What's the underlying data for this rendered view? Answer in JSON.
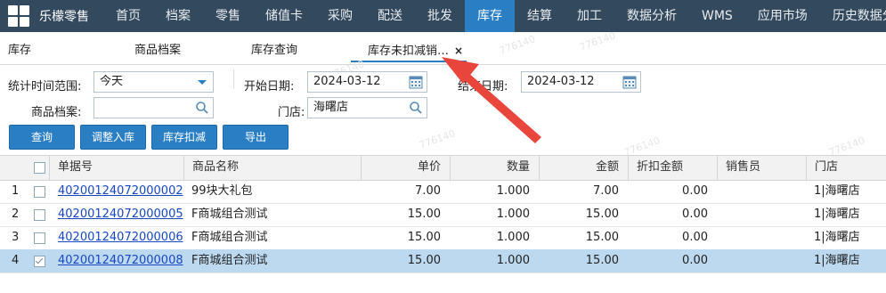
{
  "nav": {
    "brand": "乐檬零售",
    "items": [
      "首页",
      "档案",
      "零售",
      "储值卡",
      "采购",
      "配送",
      "批发",
      "库存",
      "结算",
      "加工",
      "数据分析",
      "WMS",
      "应用市场",
      "历史数据分"
    ],
    "active_index": 7
  },
  "tabs": {
    "items": [
      "库存",
      "商品档案",
      "库存查询",
      "库存未扣减销…"
    ],
    "active_index": 3,
    "close_glyph": "×"
  },
  "form": {
    "range_label": "统计时间范围:",
    "range_value": "今天",
    "start_label": "开始日期:",
    "start_value": "2024-03-12",
    "end_label": "结束日期:",
    "end_value": "2024-03-12",
    "product_label": "商品档案:",
    "product_value": "",
    "store_label": "门店:",
    "store_value": "海曙店"
  },
  "buttons": {
    "query": "查询",
    "adjust": "调整入库",
    "deduct": "库存扣减",
    "export": "导出"
  },
  "table": {
    "headers": [
      "单据号",
      "商品名称",
      "单价",
      "数量",
      "金额",
      "折扣金额",
      "销售员",
      "门店"
    ],
    "rows": [
      {
        "idx": "1",
        "doc": "40200124072000002",
        "name": "99块大礼包",
        "price": "7.00",
        "qty": "1.000",
        "amount": "7.00",
        "discount": "0.00",
        "staff": "",
        "store": "1|海曙店",
        "checked": false
      },
      {
        "idx": "2",
        "doc": "40200124072000005",
        "name": "F商城组合测试",
        "price": "15.00",
        "qty": "1.000",
        "amount": "15.00",
        "discount": "0.00",
        "staff": "",
        "store": "1|海曙店",
        "checked": false
      },
      {
        "idx": "3",
        "doc": "40200124072000006",
        "name": "F商城组合测试",
        "price": "15.00",
        "qty": "1.000",
        "amount": "15.00",
        "discount": "0.00",
        "staff": "",
        "store": "1|海曙店",
        "checked": false
      },
      {
        "idx": "4",
        "doc": "40200124072000008",
        "name": "F商城组合测试",
        "price": "15.00",
        "qty": "1.000",
        "amount": "15.00",
        "discount": "0.00",
        "staff": "",
        "store": "1|海曙店",
        "checked": true
      }
    ]
  },
  "watermark": "776140",
  "colors": {
    "nav_bg": "#33495e",
    "accent": "#2a7fc4",
    "selected_row": "#bcd9f0",
    "arrow": "#e8453c"
  }
}
